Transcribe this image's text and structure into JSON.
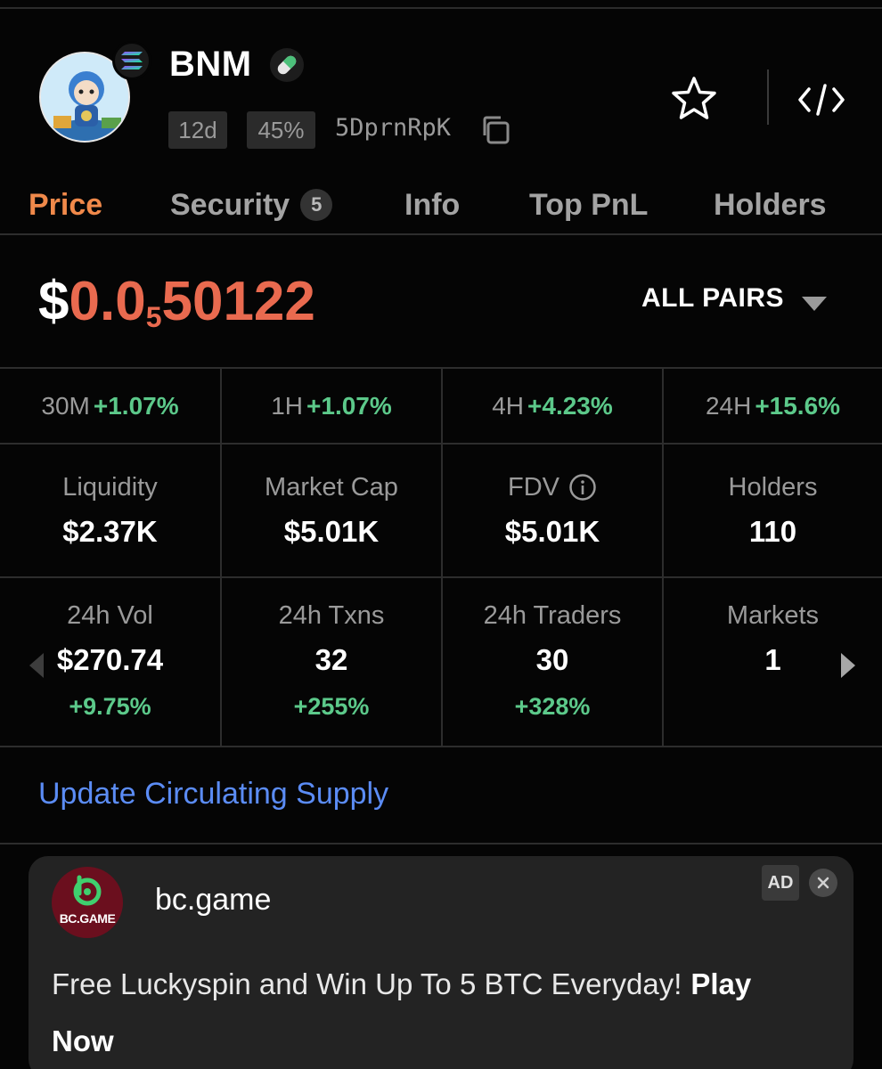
{
  "token": {
    "name": "BNM",
    "age": "12d",
    "percent": "45%",
    "address": "5DprnRpK"
  },
  "tabs": [
    {
      "label": "Price",
      "active": true
    },
    {
      "label": "Security",
      "badge": "5"
    },
    {
      "label": "Info"
    },
    {
      "label": "Top PnL"
    },
    {
      "label": "Holders"
    }
  ],
  "price": {
    "currency": "$",
    "prefix": "0.0",
    "zeros_subscript": "5",
    "digits": "50122",
    "pairs_label": "ALL PAIRS"
  },
  "changes": [
    {
      "period": "30M",
      "value": "+1.07%"
    },
    {
      "period": "1H",
      "value": "+1.07%"
    },
    {
      "period": "4H",
      "value": "+4.23%"
    },
    {
      "period": "24H",
      "value": "+15.6%"
    }
  ],
  "stats": [
    {
      "label": "Liquidity",
      "value": "$2.37K"
    },
    {
      "label": "Market Cap",
      "value": "$5.01K"
    },
    {
      "label": "FDV",
      "value": "$5.01K"
    },
    {
      "label": "Holders",
      "value": "110"
    }
  ],
  "activity": [
    {
      "label": "24h Vol",
      "value": "$270.74",
      "change": "+9.75%"
    },
    {
      "label": "24h Txns",
      "value": "32",
      "change": "+255%"
    },
    {
      "label": "24h Traders",
      "value": "30",
      "change": "+328%"
    },
    {
      "label": "Markets",
      "value": "1",
      "change": ""
    }
  ],
  "update_link": "Update Circulating Supply",
  "ad": {
    "logo_text": "BC.GAME",
    "host": "bc.game",
    "tag": "AD",
    "message": "Free Luckyspin and Win Up To 5 BTC Everyday!",
    "cta": "Play Now"
  },
  "colors": {
    "background": "#050505",
    "accent_orange": "#f0894a",
    "price_red": "#e96a4f",
    "positive_green": "#5cc98a",
    "link_blue": "#5b8cf5"
  },
  "icons": [
    "solana-icon",
    "pill-icon",
    "copy-icon",
    "star-icon",
    "code-embed-icon",
    "caret-down-icon",
    "info-icon",
    "chevron-left-icon",
    "chevron-right-icon",
    "close-icon"
  ]
}
